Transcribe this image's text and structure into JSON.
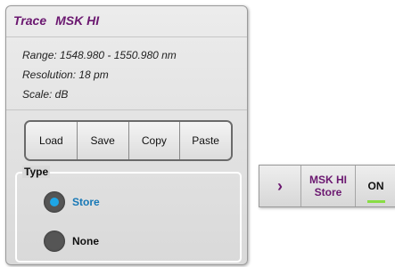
{
  "panel": {
    "title_prefix": "Trace",
    "trace_name": "MSK HI",
    "range": "Range: 1548.980 - 1550.980 nm",
    "resolution": "Resolution: 18 pm",
    "scale": "Scale: dB",
    "buttons": {
      "load": "Load",
      "save": "Save",
      "copy": "Copy",
      "paste": "Paste"
    },
    "type_group": {
      "legend": "Type",
      "options": [
        {
          "label": "Store",
          "selected": true
        },
        {
          "label": "None",
          "selected": false
        }
      ]
    }
  },
  "trace_bar": {
    "expand_glyph": "›",
    "name_line1": "MSK HI",
    "name_line2": "Store",
    "state": "ON",
    "state_indicator_color": "#88dd44"
  },
  "colors": {
    "accent_purple": "#6b1870",
    "selected_blue": "#1778b6",
    "radio_dot": "#1ea6e6"
  }
}
